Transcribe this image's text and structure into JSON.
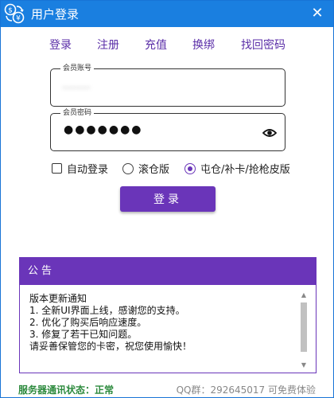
{
  "window": {
    "title": "用户登录",
    "close_glyph": "✕"
  },
  "nav": {
    "items": [
      "登录",
      "注册",
      "充值",
      "换绑",
      "找回密码"
    ]
  },
  "account": {
    "label": "会员账号",
    "value": "········"
  },
  "password": {
    "label": "会员密码",
    "masked": "●●●●●●●"
  },
  "options": {
    "auto_login": "自动登录",
    "mode_a": "滚仓版",
    "mode_b": "屯仓/补卡/抢枪皮版",
    "auto_login_checked": false,
    "selected_mode": "mode_b"
  },
  "login_button": "登录",
  "notice": {
    "header": "公告",
    "lines": [
      "版本更新通知",
      "1. 全新UI界面上线，感谢您的支持。",
      "2. 优化了购买后响应速度。",
      "3. 修复了若干已知问题。",
      "请妥善保管您的卡密，祝您使用愉快！"
    ]
  },
  "status": {
    "server": "服务器通讯状态：正常",
    "qq": "QQ群：292645017 可免费体验"
  },
  "colors": {
    "titlebar": "#1a7fe0",
    "accent": "#6a35b9",
    "status_ok": "#2c8a3d"
  }
}
